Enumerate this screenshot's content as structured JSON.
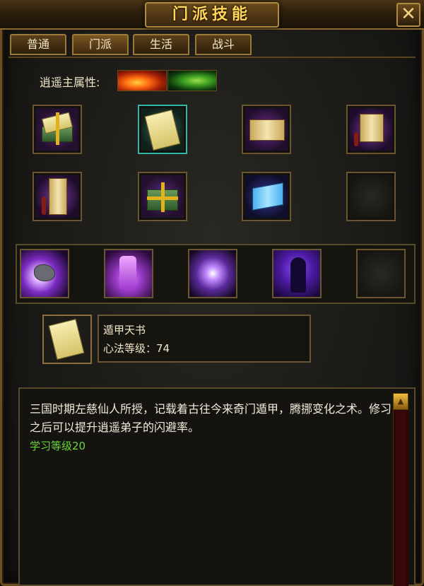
{
  "window": {
    "title": "门派技能",
    "close_glyph": "✕"
  },
  "tabs": [
    {
      "label": "普通",
      "active": false
    },
    {
      "label": "门派",
      "active": true
    },
    {
      "label": "生活",
      "active": false
    },
    {
      "label": "战斗",
      "active": false
    }
  ],
  "attribute": {
    "label": "逍遥主属性:",
    "icons": [
      "fire-icon",
      "wind-icon"
    ]
  },
  "skill_books": [
    {
      "icon": "book-bundle-icon",
      "selected": false
    },
    {
      "icon": "dunjia-book-icon",
      "selected": true
    },
    {
      "icon": "golden-scroll-icon",
      "selected": false
    },
    {
      "icon": "hanging-scroll-icon",
      "selected": false
    },
    {
      "icon": "painting-scroll-icon",
      "selected": false
    },
    {
      "icon": "ribboned-book-bundle-icon",
      "selected": false
    },
    {
      "icon": "blue-scroll-icon",
      "selected": false
    },
    {
      "icon": "empty-slot-icon",
      "selected": false
    }
  ],
  "active_skills": [
    {
      "icon": "meteor-rock-icon"
    },
    {
      "icon": "purple-boot-icon"
    },
    {
      "icon": "vortex-icon"
    },
    {
      "icon": "shadow-figure-icon"
    },
    {
      "icon": "empty-slot-icon"
    }
  ],
  "selected_skill": {
    "name": "遁甲天书",
    "level_text": "心法等级：74",
    "icon": "dunjia-book-icon"
  },
  "description": {
    "text": "三国时期左慈仙人所授，记载着古往今来奇门遁甲，腾挪变化之术。修习之后可以提升逍遥弟子的闪避率。",
    "requirement": "学习等级20"
  },
  "colors": {
    "title": "#ffd75a",
    "requirement": "#6ad63a",
    "frame_gold": "#b08a3e",
    "selected_border": "#2fb8a8"
  }
}
